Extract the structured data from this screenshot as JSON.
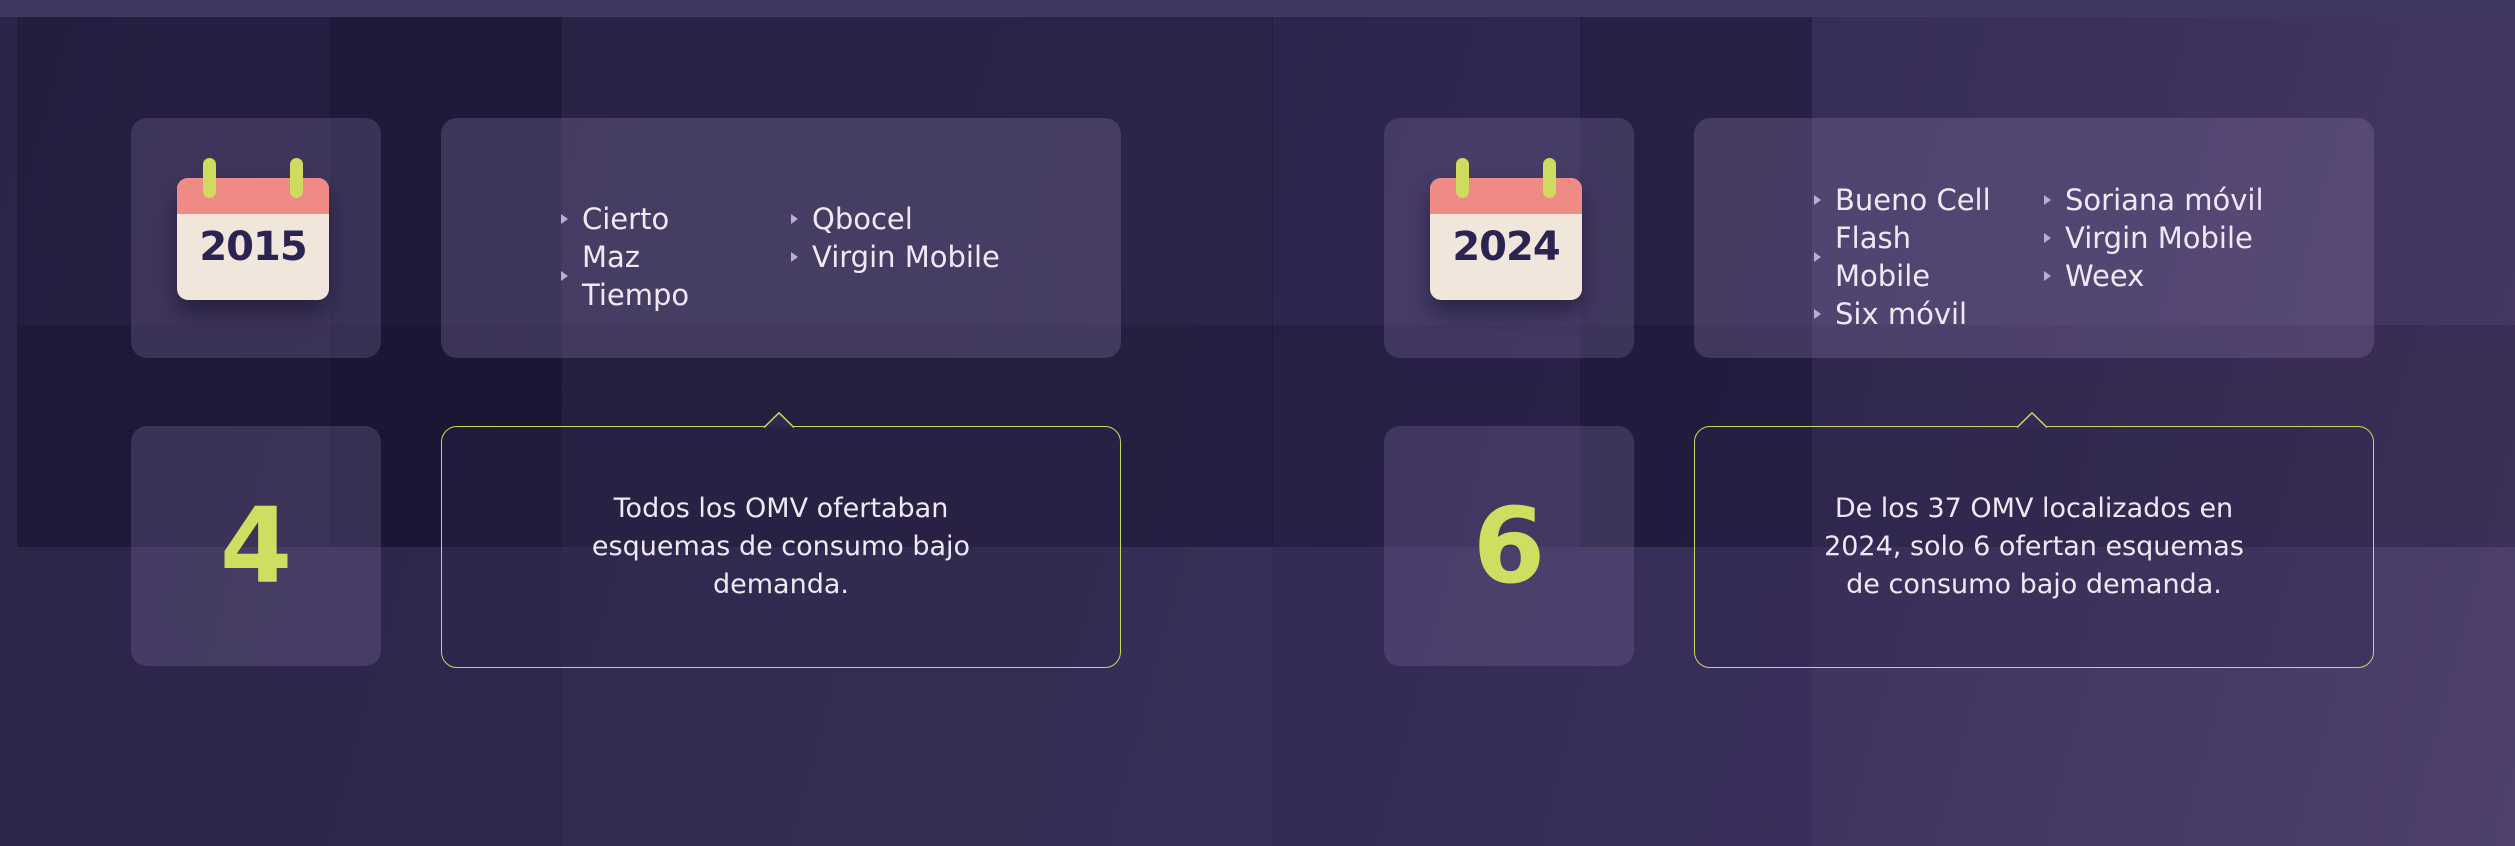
{
  "colors": {
    "accent_lime": "#cfdd60",
    "calendar_red": "#ef8a85",
    "calendar_paper": "#f1e6db",
    "text_light": "#efe9f4",
    "background": "#302a52"
  },
  "panels": [
    {
      "year": "2015",
      "operators": [
        [
          "Cierto",
          "Maz Tiempo"
        ],
        [
          "Qbocel",
          "Virgin Mobile"
        ]
      ],
      "count": "4",
      "note": "Todos los OMV ofertaban esquemas de consumo bajo demanda."
    },
    {
      "year": "2024",
      "operators": [
        [
          "Bueno Cell",
          "Flash Mobile",
          "Six móvil"
        ],
        [
          "Soriana móvil",
          "Virgin Mobile",
          "Weex"
        ]
      ],
      "count": "6",
      "note": "De los 37 OMV localizados en 2024, solo 6 ofertan esquemas de consumo bajo demanda."
    }
  ]
}
